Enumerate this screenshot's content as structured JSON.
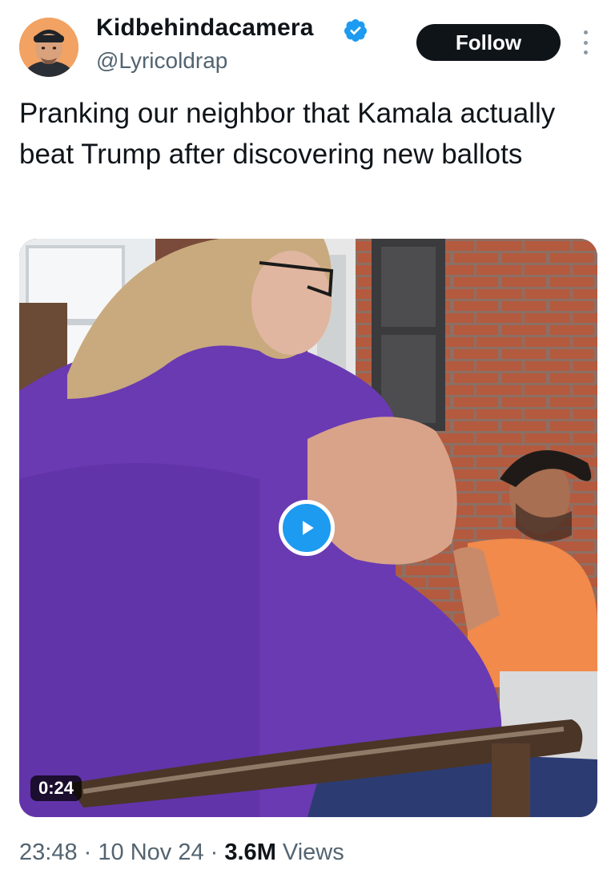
{
  "author": {
    "display_name": "Kidbehindacamera",
    "handle": "@Lyricoldrap",
    "verified_icon": "verified-badge-icon",
    "avatar_icon": "user-avatar"
  },
  "actions": {
    "follow_label": "Follow",
    "more_icon": "more-vertical-icon"
  },
  "tweet": {
    "text": "Pranking our neighbor that Kamala actually beat Trump after discovering new ballots"
  },
  "media": {
    "type": "video",
    "duration": "0:24",
    "play_icon": "play-icon"
  },
  "meta": {
    "time": "23:48",
    "separator": "·",
    "date": "10 Nov 24",
    "views_count": "3.6M",
    "views_label": "Views"
  },
  "colors": {
    "accent": "#1d9bf0",
    "text": "#0f1419",
    "secondary_text": "#536471",
    "follow_button_bg": "#0f1419"
  }
}
